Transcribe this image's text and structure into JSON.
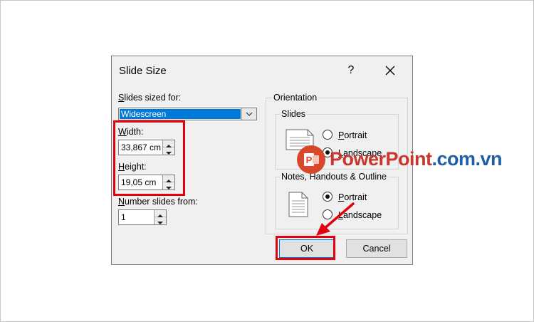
{
  "dialog": {
    "title": "Slide Size",
    "help_label": "?",
    "slides_sized_for": {
      "label": "Slides sized for:",
      "value": "Widescreen"
    },
    "width": {
      "label": "Width:",
      "value": "33,867 cm"
    },
    "height": {
      "label": "Height:",
      "value": "19,05 cm"
    },
    "number_slides_from": {
      "label": "Number slides from:",
      "value": "1"
    },
    "orientation": {
      "title": "Orientation",
      "slides": {
        "title": "Slides",
        "options": [
          "Portrait",
          "Landscape"
        ],
        "selected": "Landscape"
      },
      "notes": {
        "title": "Notes, Handouts & Outline",
        "options": [
          "Portrait",
          "Landscape"
        ],
        "selected": "Portrait"
      }
    },
    "ok_label": "OK",
    "cancel_label": "Cancel"
  },
  "watermark": {
    "part1": "PowerPoint",
    "part2": ".com.vn",
    "logo_letter": "P"
  },
  "colors": {
    "highlight": "#e3000f",
    "selection": "#0078d7",
    "dialog_bg": "#f0f0f0"
  }
}
